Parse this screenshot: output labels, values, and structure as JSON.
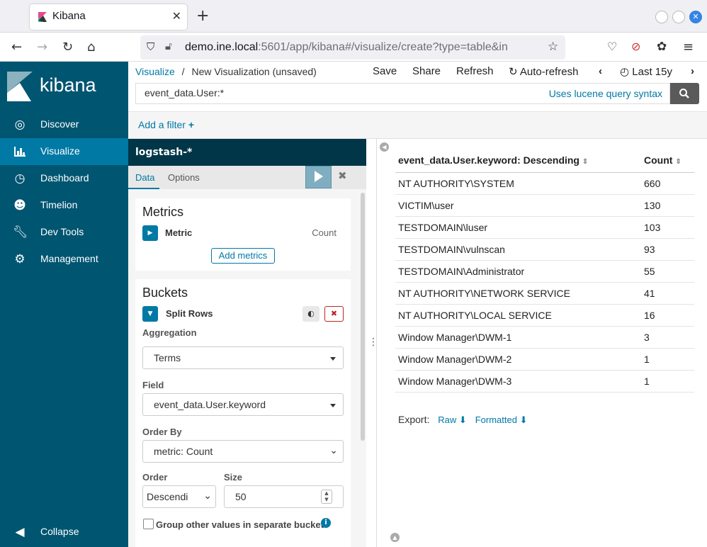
{
  "browser": {
    "tab_title": "Kibana",
    "url_host": "demo.ine.local",
    "url_rest": ":5601/app/kibana#/visualize/create?type=table&in"
  },
  "sidebar": {
    "logo_text": "kibana",
    "items": [
      {
        "label": "Discover",
        "icon": "compass-icon"
      },
      {
        "label": "Visualize",
        "icon": "bar-chart-icon"
      },
      {
        "label": "Dashboard",
        "icon": "dashboard-icon"
      },
      {
        "label": "Timelion",
        "icon": "timelion-icon"
      },
      {
        "label": "Dev Tools",
        "icon": "wrench-icon"
      },
      {
        "label": "Management",
        "icon": "gear-icon"
      }
    ],
    "collapse_label": "Collapse"
  },
  "header": {
    "breadcrumb_root": "Visualize",
    "breadcrumb_sep": "/",
    "breadcrumb_current": "New Visualization (unsaved)",
    "save": "Save",
    "share": "Share",
    "refresh": "Refresh",
    "auto_refresh": "Auto-refresh",
    "time_range": "Last 15y",
    "query": "event_data.User:*",
    "query_hint": "Uses lucene query syntax"
  },
  "filter": {
    "add_label": "Add a filter"
  },
  "editor": {
    "index_pattern": "logstash-*",
    "tab_data": "Data",
    "tab_options": "Options",
    "metrics_title": "Metrics",
    "metric_label": "Metric",
    "metric_value": "Count",
    "add_metrics": "Add metrics",
    "buckets_title": "Buckets",
    "split_rows": "Split Rows",
    "aggregation_label": "Aggregation",
    "aggregation_value": "Terms",
    "field_label": "Field",
    "field_value": "event_data.User.keyword",
    "order_by_label": "Order By",
    "order_by_value": "metric: Count",
    "order_label": "Order",
    "order_value": "Descendi",
    "size_label": "Size",
    "size_value": "50",
    "group_other": "Group other values in separate bucket"
  },
  "results": {
    "col1": "event_data.User.keyword: Descending",
    "col2": "Count",
    "rows": [
      {
        "user": "NT AUTHORITY\\SYSTEM",
        "count": "660"
      },
      {
        "user": "VICTIM\\user",
        "count": "130"
      },
      {
        "user": "TESTDOMAIN\\luser",
        "count": "103"
      },
      {
        "user": "TESTDOMAIN\\vulnscan",
        "count": "93"
      },
      {
        "user": "TESTDOMAIN\\Administrator",
        "count": "55"
      },
      {
        "user": "NT AUTHORITY\\NETWORK SERVICE",
        "count": "41"
      },
      {
        "user": "NT AUTHORITY\\LOCAL SERVICE",
        "count": "16"
      },
      {
        "user": "Window Manager\\DWM-1",
        "count": "3"
      },
      {
        "user": "Window Manager\\DWM-2",
        "count": "1"
      },
      {
        "user": "Window Manager\\DWM-3",
        "count": "1"
      }
    ],
    "export_label": "Export:",
    "export_raw": "Raw",
    "export_formatted": "Formatted"
  },
  "colors": {
    "sidebar": "#005571",
    "active": "#0079a5",
    "index_bar": "#003648",
    "link": "#0079a5"
  }
}
